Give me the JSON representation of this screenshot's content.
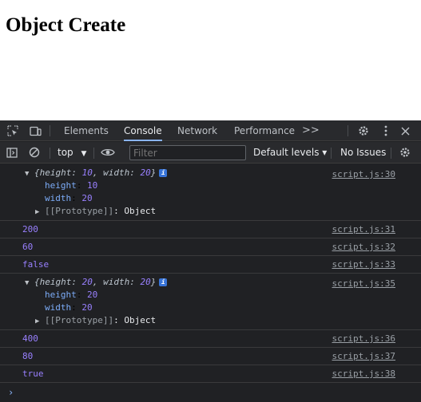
{
  "page": {
    "heading": "Object Create"
  },
  "devtools": {
    "tabs": [
      {
        "label": "Elements",
        "active": false
      },
      {
        "label": "Console",
        "active": true
      },
      {
        "label": "Network",
        "active": false
      },
      {
        "label": "Performance",
        "active": false
      }
    ],
    "more_tabs": ">>",
    "toolbar": {
      "context": "top",
      "filter_placeholder": "Filter",
      "levels": "Default levels ▾",
      "issues": "No Issues"
    },
    "console": {
      "obj1": {
        "summary_a": "{height: ",
        "h": "10",
        "summary_b": ", width: ",
        "w": "20",
        "summary_c": "}",
        "height_key": "height",
        "height_val": "10",
        "width_key": "width",
        "width_val": "20",
        "proto": "[[Prototype]]",
        "proto_val": "Object",
        "src": "script.js:30"
      },
      "v1": {
        "text": "200",
        "src": "script.js:31"
      },
      "v2": {
        "text": "60",
        "src": "script.js:32"
      },
      "v3": {
        "text": "false",
        "src": "script.js:33"
      },
      "obj2": {
        "summary_a": "{height: ",
        "h": "20",
        "summary_b": ", width: ",
        "w": "20",
        "summary_c": "}",
        "height_key": "height",
        "height_val": "20",
        "width_key": "width",
        "width_val": "20",
        "proto": "[[Prototype]]",
        "proto_val": "Object",
        "src": "script.js:35"
      },
      "v4": {
        "text": "400",
        "src": "script.js:36"
      },
      "v5": {
        "text": "80",
        "src": "script.js:37"
      },
      "v6": {
        "text": "true",
        "src": "script.js:38"
      },
      "prompt": "›"
    },
    "colors": {
      "accent": "#8ab4f8",
      "number": "#9980ff",
      "key": "#7cacf8",
      "bg": "#202124"
    }
  }
}
